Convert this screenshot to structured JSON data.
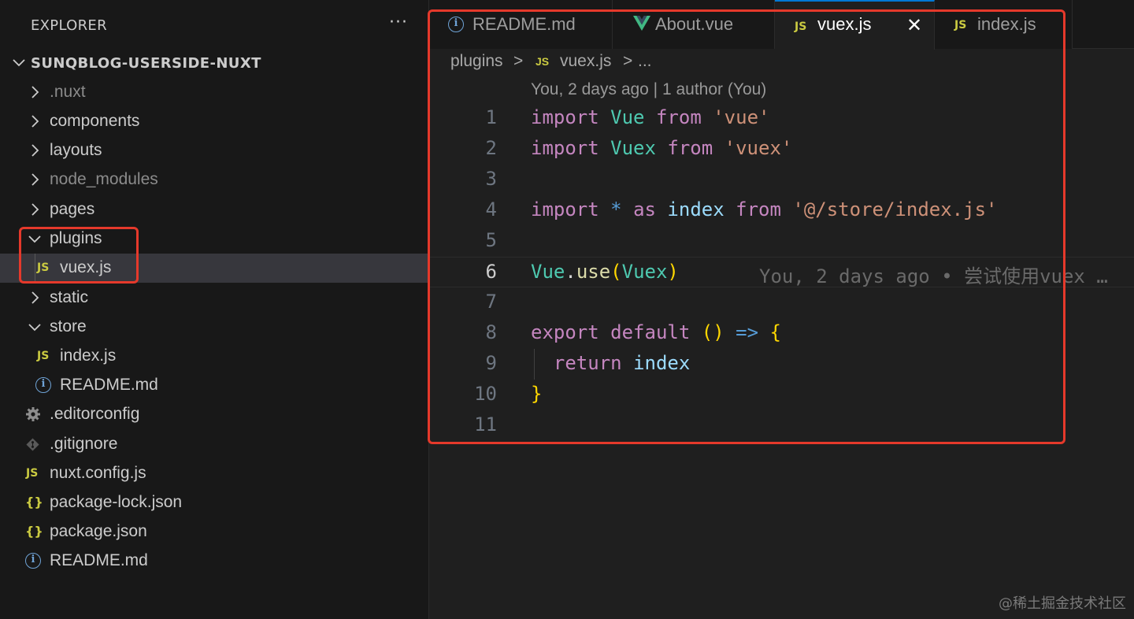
{
  "explorer": {
    "title": "EXPLORER",
    "more": "···",
    "project": "SUNQBLOG-USERSIDE-NUXT",
    "items": [
      {
        "label": ".nuxt",
        "type": "folder",
        "expanded": false,
        "dim": true
      },
      {
        "label": "components",
        "type": "folder",
        "expanded": false
      },
      {
        "label": "layouts",
        "type": "folder",
        "expanded": false
      },
      {
        "label": "node_modules",
        "type": "folder",
        "expanded": false,
        "dim": true
      },
      {
        "label": "pages",
        "type": "folder",
        "expanded": false
      },
      {
        "label": "plugins",
        "type": "folder",
        "expanded": true
      },
      {
        "label": "vuex.js",
        "type": "js",
        "icon": "JS",
        "selected": true
      },
      {
        "label": "static",
        "type": "folder",
        "expanded": false
      },
      {
        "label": "store",
        "type": "folder",
        "expanded": true
      },
      {
        "label": "index.js",
        "type": "js",
        "icon": "JS"
      },
      {
        "label": "README.md",
        "type": "info",
        "icon": "i"
      },
      {
        "label": ".editorconfig",
        "type": "gear"
      },
      {
        "label": ".gitignore",
        "type": "git"
      },
      {
        "label": "nuxt.config.js",
        "type": "js",
        "icon": "JS"
      },
      {
        "label": "package-lock.json",
        "type": "json",
        "icon": "{}"
      },
      {
        "label": "package.json",
        "type": "json",
        "icon": "{}"
      },
      {
        "label": "README.md",
        "type": "info",
        "icon": "i"
      }
    ]
  },
  "tabs": [
    {
      "label": "README.md",
      "icon": "i"
    },
    {
      "label": "About.vue",
      "icon": "V"
    },
    {
      "label": "vuex.js",
      "icon": "JS",
      "active": true,
      "close": "✕"
    },
    {
      "label": "index.js",
      "icon": "JS"
    }
  ],
  "breadcrumb": {
    "folder": "plugins",
    "sep1": ">",
    "icon": "JS",
    "file": "vuex.js",
    "sep2": ">",
    "more": "..."
  },
  "blame": {
    "header": "You, 2 days ago | 1 author (You)",
    "inline": "You, 2 days ago • 尝试使用vuex …"
  },
  "code": {
    "line_numbers": [
      "1",
      "2",
      "3",
      "4",
      "5",
      "6",
      "7",
      "8",
      "9",
      "10",
      "11"
    ],
    "current_line": "6",
    "l1": {
      "kw": "import",
      "name": "Vue",
      "from": "from",
      "str": "'vue'"
    },
    "l2": {
      "kw": "import",
      "name": "Vuex",
      "from": "from",
      "str": "'vuex'"
    },
    "l4": {
      "kw": "import",
      "star": "*",
      "as": "as",
      "name": "index",
      "from": "from",
      "str": "'@/store/index.js'"
    },
    "l6": {
      "obj": "Vue",
      "dot": ".",
      "fn": "use",
      "open": "(",
      "arg": "Vuex",
      "close": ")"
    },
    "l8": {
      "kw1": "export",
      "kw2": "default",
      "parens": "()",
      "arrow": "=>",
      "brace": "{"
    },
    "l9": {
      "kw": "return",
      "name": "index"
    },
    "l10": {
      "brace": "}"
    }
  },
  "watermark": "@稀土掘金技术社区",
  "colors": {
    "annotation": "#e5392b",
    "accent": "#0078d4",
    "js_icon": "#cbcb41",
    "vue_icon": "#41b883"
  }
}
